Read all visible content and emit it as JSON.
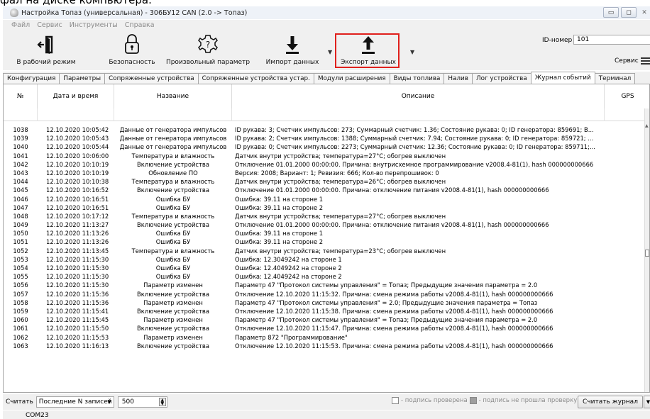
{
  "page_caption": "фал на диске компьютера.",
  "window": {
    "title": "Настройка Топаз (универсальная) - 306БУ12 CAN (2.0 -> Топаз)",
    "min": "▭",
    "max": "◻",
    "close": "✕"
  },
  "menu": [
    "Файл",
    "Сервис",
    "Инструменты",
    "Справка"
  ],
  "toolbar": {
    "work_mode": "В рабочий режим",
    "security": "Безопасность",
    "custom_param": "Произвольный параметр",
    "import": "Импорт данных",
    "export": "Экспорт данных",
    "id_label": "ID-номер",
    "id_value": "101",
    "service": "Сервис"
  },
  "tabs": [
    "Конфигурация",
    "Параметры",
    "Сопряженные устройства",
    "Сопряженные устройства устар.",
    "Модули расширения",
    "Виды топлива",
    "Налив",
    "Лог устройства",
    "Журнал событий",
    "Терминал"
  ],
  "active_tab": "Журнал событий",
  "table": {
    "headers": [
      "№",
      "Дата и время",
      "Название",
      "Описание",
      "GPS"
    ],
    "rows": [
      [
        "1038",
        "12.10.2020 10:05:42",
        "Данные от генератора импульсов",
        "ID рукава: 3; Счетчик импульсов: 273; Суммарный счетчик: 1.36; Состояние рукава: 0; ID генератора: 859691; В..."
      ],
      [
        "1039",
        "12.10.2020 10:05:43",
        "Данные от генератора импульсов",
        "ID рукава: 2; Счетчик импульсов: 1388; Суммарный счетчик: 7.94; Состояние рукава: 0; ID генератора: 859721; ..."
      ],
      [
        "1040",
        "12.10.2020 10:05:44",
        "Данные от генератора импульсов",
        "ID рукава: 0; Счетчик импульсов: 2273; Суммарный счетчик: 12.36; Состояние рукава: 0; ID генератора: 859711;..."
      ],
      [
        "1041",
        "12.10.2020 10:06:00",
        "Температура и влажность",
        "Датчик внутри устройства; температура=27°C; обогрев выключен"
      ],
      [
        "1042",
        "12.10.2020 10:10:19",
        "Включение устройства",
        "Отключение 01.01.2000 00:00:00. Причина: внутрисхемное программирование v2008.4-81(1), hash 000000000666"
      ],
      [
        "1043",
        "12.10.2020 10:10:19",
        "Обновление ПО",
        "Версия: 2008; Вариант: 1; Ревизия: 666; Кол-во перепрошивок: 0"
      ],
      [
        "1044",
        "12.10.2020 10:10:38",
        "Температура и влажность",
        "Датчик внутри устройства; температура=26°C; обогрев выключен"
      ],
      [
        "1045",
        "12.10.2020 10:16:52",
        "Включение устройства",
        "Отключение 01.01.2000 00:00:00. Причина: отключение питания v2008.4-81(1), hash 000000000666"
      ],
      [
        "1046",
        "12.10.2020 10:16:51",
        "Ошибка БУ",
        "Ошибка: 39.11 на стороне 1"
      ],
      [
        "1047",
        "12.10.2020 10:16:51",
        "Ошибка БУ",
        "Ошибка: 39.11 на стороне 2"
      ],
      [
        "1048",
        "12.10.2020 10:17:12",
        "Температура и влажность",
        "Датчик внутри устройства; температура=27°C; обогрев выключен"
      ],
      [
        "1049",
        "12.10.2020 11:13:27",
        "Включение устройства",
        "Отключение 01.01.2000 00:00:00. Причина: отключение питания v2008.4-81(1), hash 000000000666"
      ],
      [
        "1050",
        "12.10.2020 11:13:26",
        "Ошибка БУ",
        "Ошибка: 39.11 на стороне 1"
      ],
      [
        "1051",
        "12.10.2020 11:13:26",
        "Ошибка БУ",
        "Ошибка: 39.11 на стороне 2"
      ],
      [
        "1052",
        "12.10.2020 11:13:45",
        "Температура и влажность",
        "Датчик внутри устройства; температура=23°C; обогрев выключен"
      ],
      [
        "1053",
        "12.10.2020 11:15:30",
        "Ошибка БУ",
        "Ошибка: 12.3049242 на стороне 1"
      ],
      [
        "1054",
        "12.10.2020 11:15:30",
        "Ошибка БУ",
        "Ошибка: 12.4049242 на стороне 2"
      ],
      [
        "1055",
        "12.10.2020 11:15:30",
        "Ошибка БУ",
        "Ошибка: 12.4049242 на стороне 2"
      ],
      [
        "1056",
        "12.10.2020 11:15:30",
        "Параметр изменен",
        "Параметр 47 \"Протокол системы управления\" = Топаз; Предыдущие значения параметра = 2.0"
      ],
      [
        "1057",
        "12.10.2020 11:15:36",
        "Включение устройства",
        "Отключение 12.10.2020 11:15:32. Причина: смена режима работы v2008.4-81(1), hash 000000000666"
      ],
      [
        "1058",
        "12.10.2020 11:15:36",
        "Параметр изменен",
        "Параметр 47 \"Протокол системы управления\" = 2.0; Предыдущие значения параметра = Топаз"
      ],
      [
        "1059",
        "12.10.2020 11:15:41",
        "Включение устройства",
        "Отключение 12.10.2020 11:15:38. Причина: смена режима работы v2008.4-81(1), hash 000000000666"
      ],
      [
        "1060",
        "12.10.2020 11:15:45",
        "Параметр изменен",
        "Параметр 47 \"Протокол системы управления\" = Топаз; Предыдущие значения параметра = 2.0"
      ],
      [
        "1061",
        "12.10.2020 11:15:50",
        "Включение устройства",
        "Отключение 12.10.2020 11:15:47. Причина: смена режима работы v2008.4-81(1), hash 000000000666"
      ],
      [
        "1062",
        "12.10.2020 11:15:53",
        "Параметр изменен",
        "Параметр 872 \"Программирование\""
      ],
      [
        "1063",
        "12.10.2020 11:16:13",
        "Включение устройства",
        "Отключение 12.10.2020 11:15:53. Причина: смена режима работы v2008.4-81(1), hash 000000000666"
      ]
    ]
  },
  "footer": {
    "read_label": "Считать",
    "mode_select": "Последние N записей",
    "count": "500",
    "legend_verified": "- подпись проверена",
    "legend_failed": "- подпись не прошла проверку",
    "read_button": "Считать журнал"
  },
  "status": {
    "port": "COM23"
  },
  "colors": {
    "export_highlight": "#e0201c",
    "window_bg": "#f0f0f0"
  },
  "icons": {
    "work_mode": "exit-door-icon",
    "security": "padlock-icon",
    "custom_param": "gear-question-icon",
    "import": "download-arrow-icon",
    "export": "upload-arrow-icon",
    "service": "hamburger-menu-icon"
  }
}
